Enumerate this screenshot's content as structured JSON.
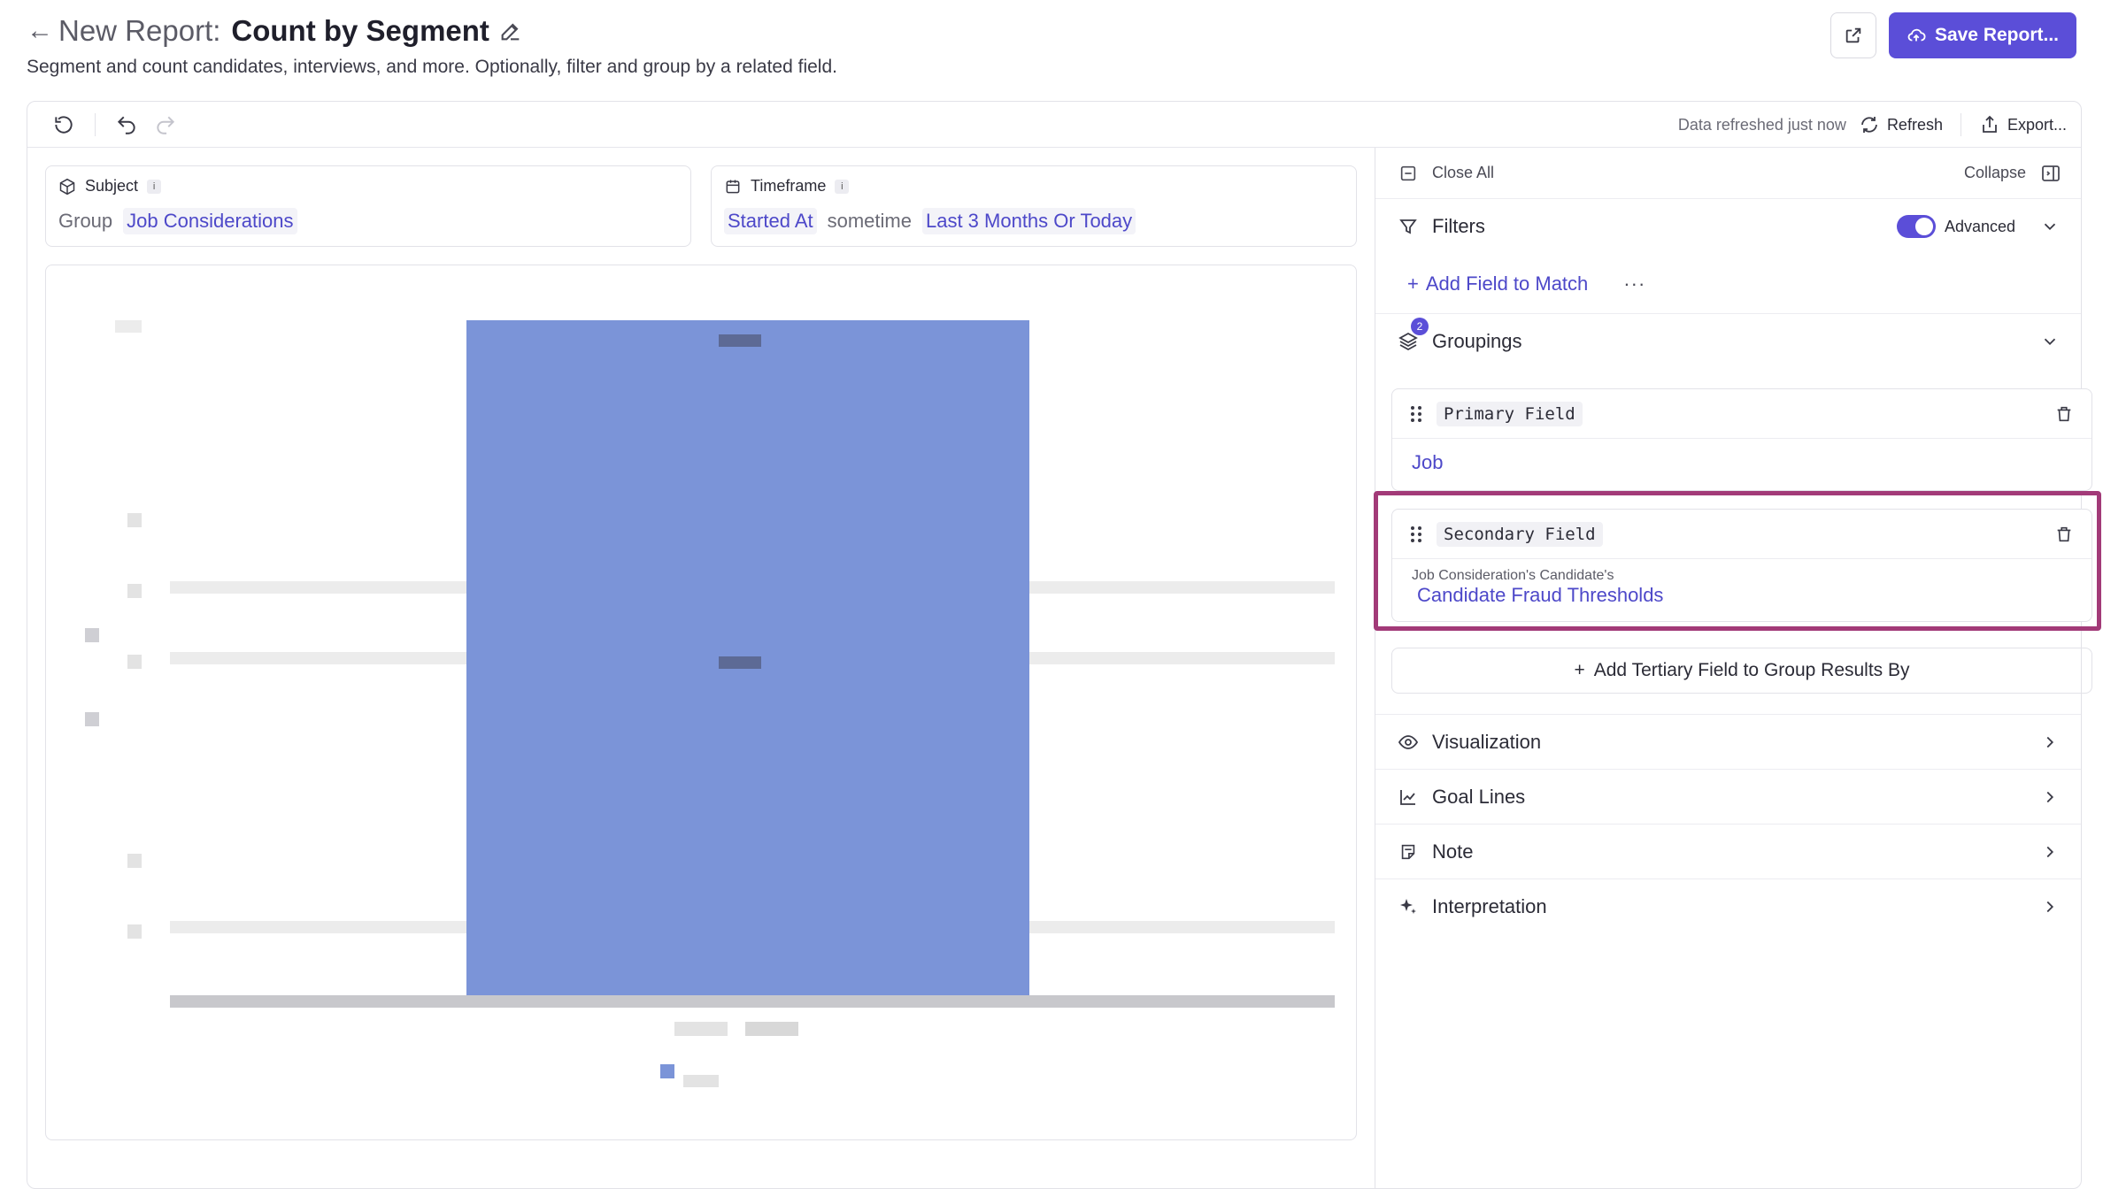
{
  "header": {
    "title_prefix": "New Report:",
    "title_name": "Count by Segment",
    "subtitle": "Segment and count candidates, interviews, and more. Optionally, filter and group by a related field.",
    "save_label": "Save Report..."
  },
  "toolbar": {
    "refresh_note": "Data refreshed just now",
    "refresh_label": "Refresh",
    "export_label": "Export..."
  },
  "subject": {
    "label": "Subject",
    "info": "i",
    "prefix": "Group",
    "value": "Job Considerations"
  },
  "timeframe": {
    "label": "Timeframe",
    "info": "i",
    "field": "Started At",
    "connector": "sometime",
    "range": "Last 3 Months Or Today"
  },
  "chart_data": {
    "type": "bar",
    "categories": [],
    "values": [],
    "bar_color": "#7b94d8"
  },
  "panel": {
    "close_all": "Close All",
    "collapse": "Collapse",
    "filters": {
      "label": "Filters",
      "advanced_label": "Advanced",
      "advanced_on": true,
      "add_field": "Add Field to Match",
      "more": "···"
    },
    "groupings": {
      "label": "Groupings",
      "count": "2",
      "primary": {
        "chip": "Primary Field",
        "value": "Job"
      },
      "secondary": {
        "chip": "Secondary Field",
        "path": "Job Consideration's Candidate's",
        "value": "Candidate Fraud Thresholds"
      },
      "add_tertiary": "Add Tertiary Field to Group Results By"
    },
    "sections": [
      {
        "label": "Visualization",
        "icon": "eye-icon"
      },
      {
        "label": "Goal Lines",
        "icon": "line-chart-icon"
      },
      {
        "label": "Note",
        "icon": "note-icon"
      },
      {
        "label": "Interpretation",
        "icon": "sparkle-icon"
      }
    ]
  },
  "colors": {
    "accent": "#5b4ed8",
    "link": "#4d48c9",
    "highlight": "#a23a78",
    "bar": "#7b94d8"
  }
}
